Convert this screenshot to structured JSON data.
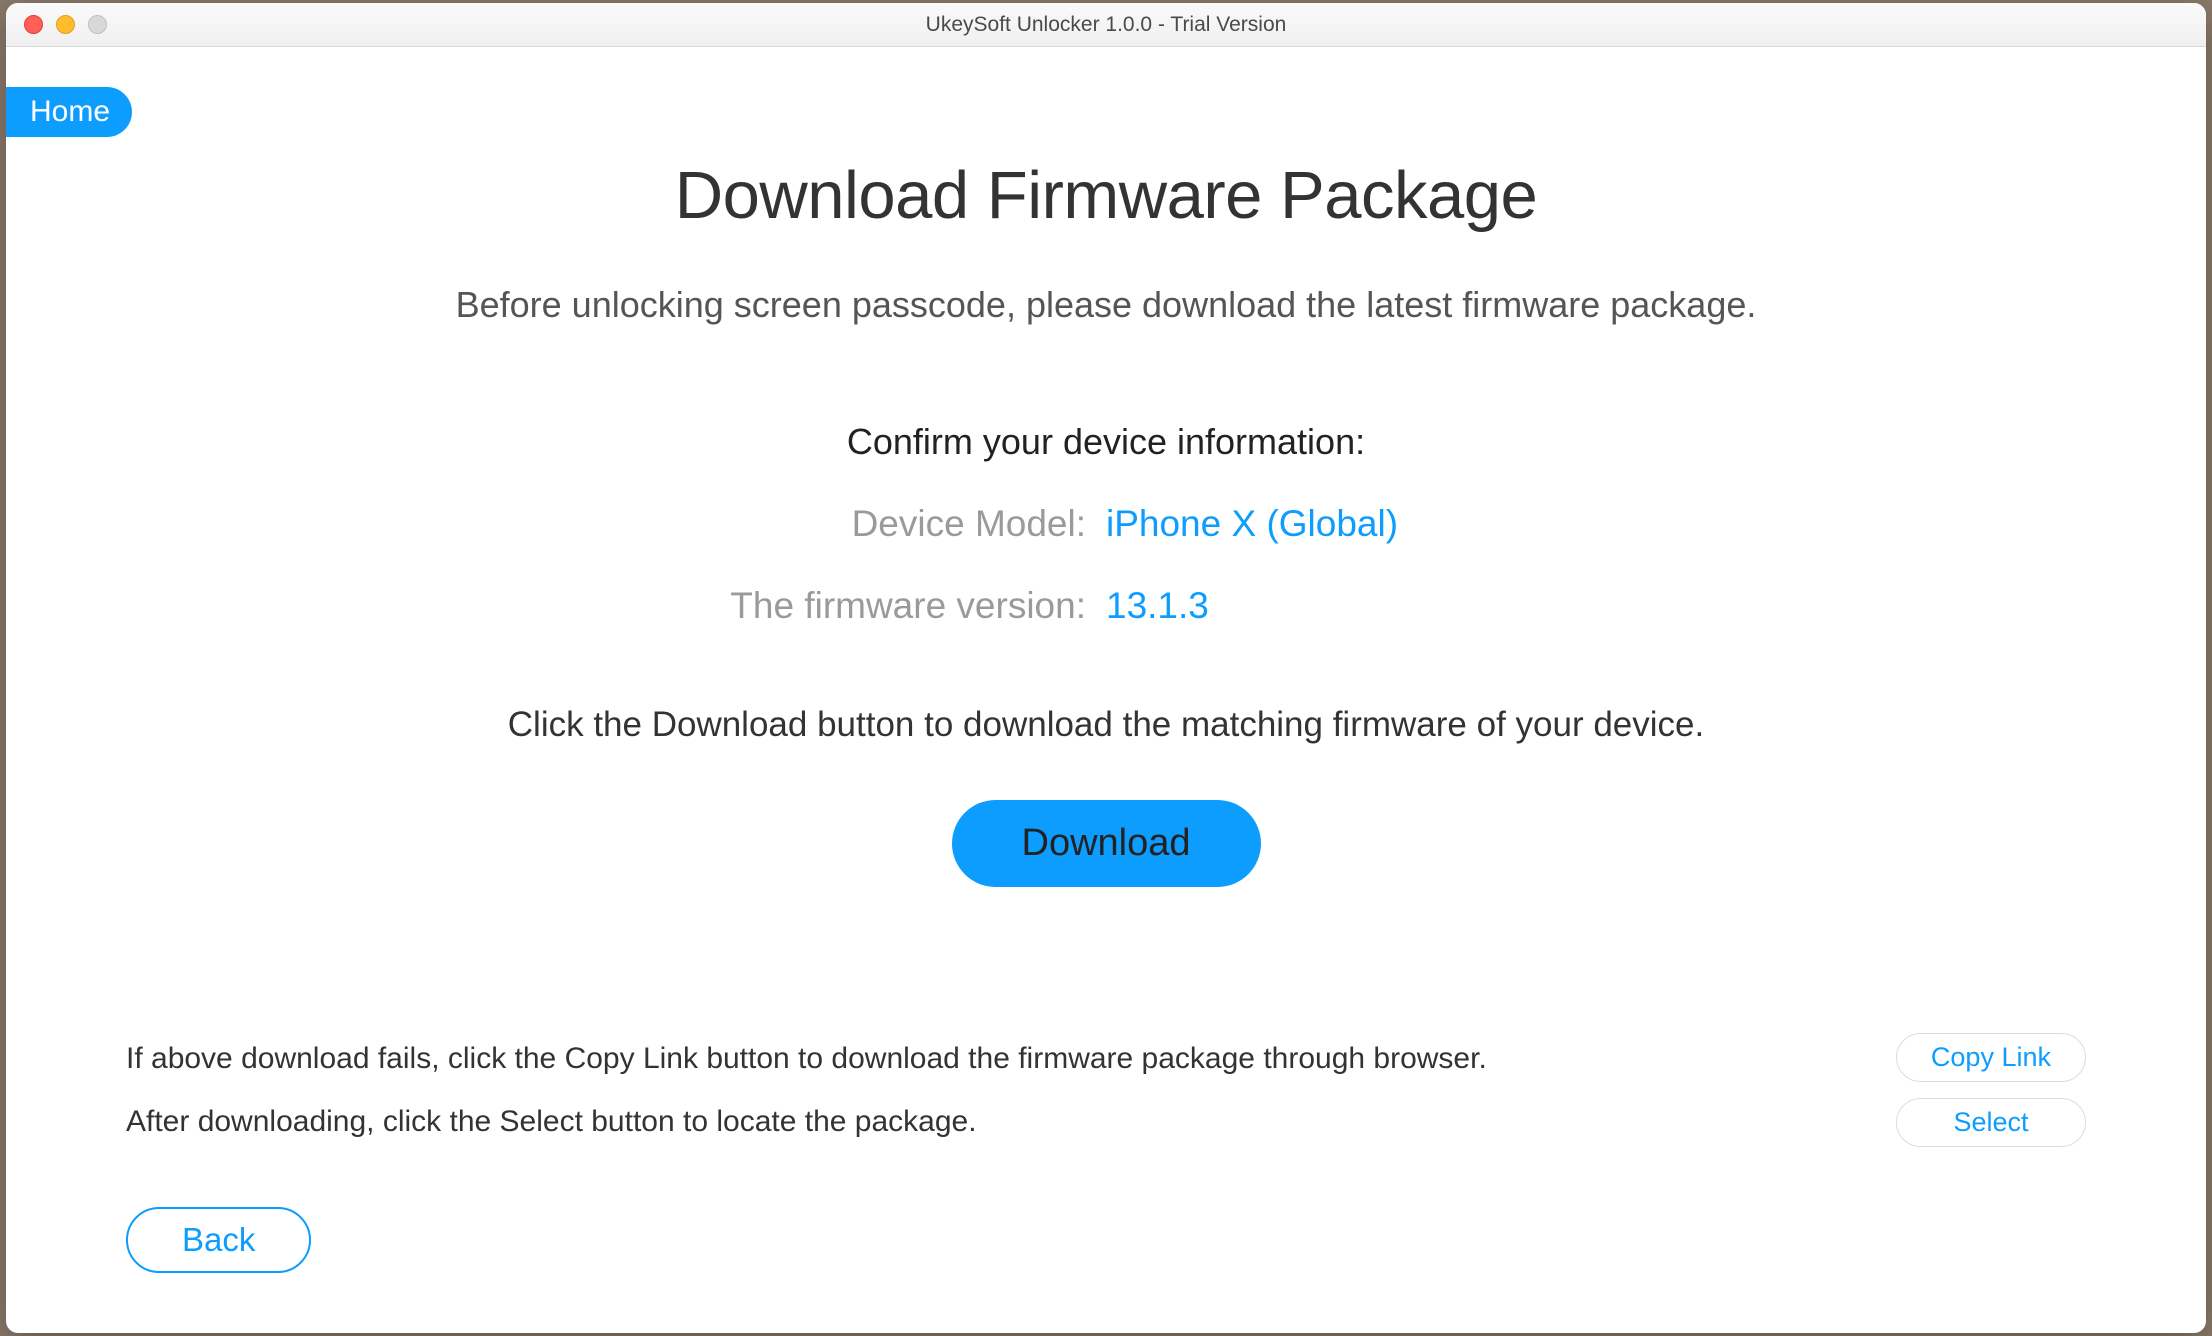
{
  "window": {
    "title": "UkeySoft Unlocker 1.0.0 - Trial Version"
  },
  "nav": {
    "home_label": "Home"
  },
  "page": {
    "title": "Download Firmware Package",
    "subtitle": "Before unlocking screen passcode, please download the latest firmware package.",
    "confirm_heading": "Confirm your device information:",
    "device_model_label": "Device Model:",
    "device_model_value": "iPhone X (Global)",
    "firmware_label": "The firmware version:",
    "firmware_value": "13.1.3",
    "download_hint": "Click the Download button to download the matching firmware of your device.",
    "download_button": "Download"
  },
  "footer": {
    "line1": "If above download fails, click the Copy Link button to download the firmware package through browser.",
    "line2": "After downloading, click the Select button to locate the package.",
    "copy_link_button": "Copy Link",
    "select_button": "Select",
    "back_button": "Back"
  }
}
